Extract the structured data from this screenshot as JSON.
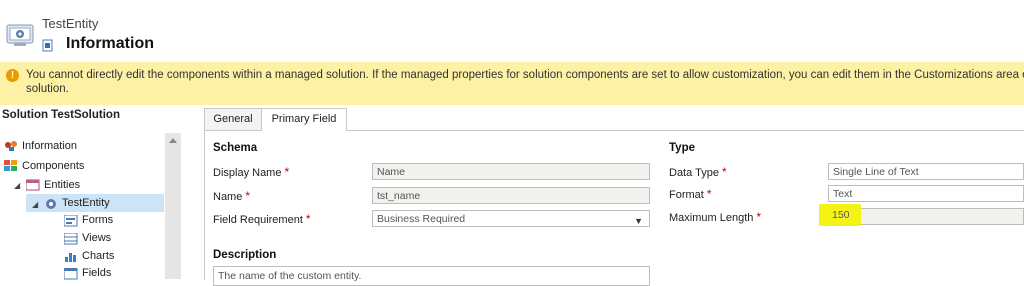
{
  "header": {
    "entity_name": "TestEntity",
    "page_heading": "Information"
  },
  "notice": {
    "line1": "You cannot directly edit the components within a managed solution. If the managed properties for solution components are set to allow customization, you can edit them in the Customizations area or from a",
    "line2": "solution."
  },
  "nav": {
    "title": "Solution TestSolution",
    "items": [
      {
        "label": "Information",
        "icon": "information-icon"
      },
      {
        "label": "Components",
        "icon": "components-icon"
      },
      {
        "label": "Entities",
        "icon": "entities-icon"
      },
      {
        "label": "TestEntity",
        "icon": "entity-icon"
      },
      {
        "label": "Forms",
        "icon": "forms-icon"
      },
      {
        "label": "Views",
        "icon": "views-icon"
      },
      {
        "label": "Charts",
        "icon": "charts-icon"
      },
      {
        "label": "Fields",
        "icon": "fields-icon"
      }
    ]
  },
  "tabs": [
    {
      "label": "General"
    },
    {
      "label": "Primary Field"
    }
  ],
  "schema": {
    "title": "Schema",
    "display_name_label": "Display Name",
    "display_name_placeholder": "Name",
    "name_label": "Name",
    "name_value": "tst_name",
    "field_requirement_label": "Field Requirement",
    "field_requirement_value": "Business Required"
  },
  "type": {
    "title": "Type",
    "data_type_label": "Data Type",
    "data_type_value": "Single Line of Text",
    "format_label": "Format",
    "format_value": "Text",
    "max_length_label": "Maximum Length",
    "max_length_value": "150"
  },
  "description": {
    "title": "Description",
    "value": "The name of the custom entity."
  },
  "required_marker": "*",
  "colors": {
    "notice_bg": "#fcf1a4",
    "highlight": "#f4f20a",
    "nav_selected": "#cde4f7",
    "required": "#cc0000"
  }
}
